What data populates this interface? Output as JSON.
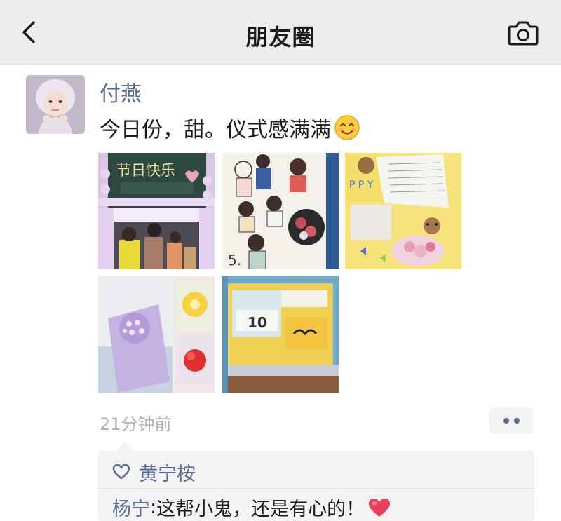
{
  "header": {
    "title": "朋友圈",
    "back_icon": "chevron-left-icon",
    "camera_icon": "camera-icon"
  },
  "post": {
    "author": "付燕",
    "text": "今日份，甜。仪式感满满",
    "emoji": "smiling-face-emoji",
    "time": "21分钟前",
    "photos": [
      {
        "name": "photo-chalkboard-festival",
        "caption": "节日快乐"
      },
      {
        "name": "photo-cartoon-drawing",
        "caption": "5."
      },
      {
        "name": "photo-yellow-card-bear"
      },
      {
        "name": "photo-purple-bouquet"
      },
      {
        "name": "photo-desk-calendar",
        "caption": "10"
      }
    ]
  },
  "interactions": {
    "likes": [
      "黄宁桉"
    ],
    "comments": [
      {
        "author": "杨宁",
        "separator": ": ",
        "text": "这帮小鬼，还是有心的！",
        "emoji": "red-heart-emoji"
      }
    ]
  },
  "colors": {
    "link": "#576b95",
    "header_bg": "#ededed",
    "comment_bg": "#f3f3f5"
  }
}
